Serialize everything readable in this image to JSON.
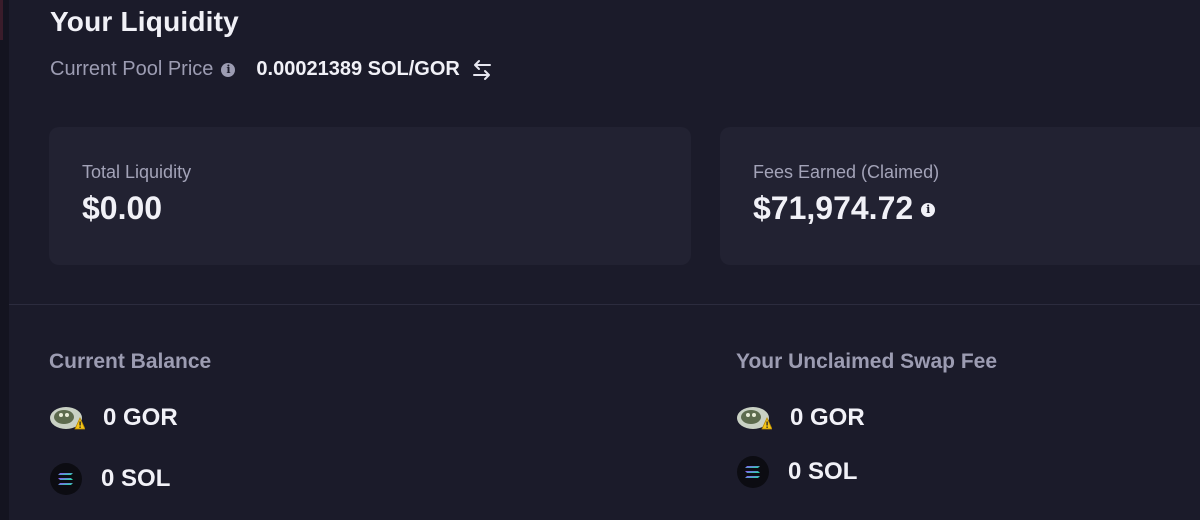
{
  "header": {
    "title": "Your Liquidity",
    "price_label": "Current Pool Price",
    "price_value": "0.00021389 SOL/GOR"
  },
  "cards": {
    "total_liquidity": {
      "label": "Total Liquidity",
      "value": "$0.00"
    },
    "fees_earned": {
      "label": "Fees Earned (Claimed)",
      "value": "$71,974.72"
    }
  },
  "current_balance": {
    "title": "Current Balance",
    "tokens": [
      {
        "amount": "0 GOR",
        "icon": "gor-token-icon"
      },
      {
        "amount": "0 SOL",
        "icon": "sol-token-icon"
      }
    ]
  },
  "unclaimed_fees": {
    "title": "Your Unclaimed Swap Fee",
    "tokens": [
      {
        "amount": "0 GOR",
        "icon": "gor-token-icon"
      },
      {
        "amount": "0 SOL",
        "icon": "sol-token-icon"
      }
    ]
  },
  "colors": {
    "background": "#1b1b2a",
    "card": "#222232",
    "muted_text": "#9c9cb2",
    "primary_text": "#f1f1f7"
  }
}
